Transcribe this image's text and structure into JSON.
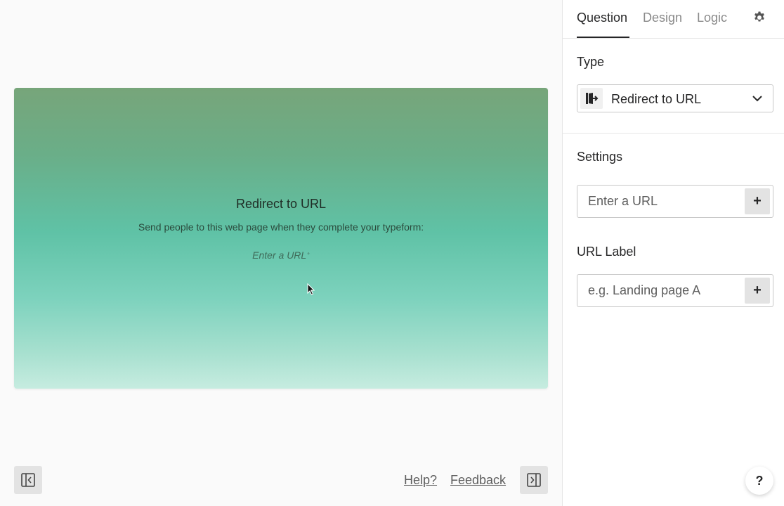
{
  "preview": {
    "title": "Redirect to URL",
    "description": "Send people to this web page when they complete your typeform:",
    "url_placeholder": "Enter a URL",
    "required_mark": "°"
  },
  "footer": {
    "help_link": "Help?",
    "feedback_link": "Feedback"
  },
  "sidebar": {
    "tabs": [
      {
        "label": "Question",
        "active": true
      },
      {
        "label": "Design",
        "active": false
      },
      {
        "label": "Logic",
        "active": false
      }
    ],
    "type": {
      "section_label": "Type",
      "selected_value": "Redirect to URL"
    },
    "settings": {
      "section_label": "Settings",
      "url_placeholder": "Enter a URL",
      "add_button": "+"
    },
    "url_label": {
      "section_label": "URL Label",
      "placeholder": "e.g. Landing page A",
      "add_button": "+"
    },
    "help_button": "?"
  },
  "colors": {
    "accent_text": "#262627",
    "muted_text": "#8a8a8a",
    "card_gradient_top": "#77a57a",
    "card_gradient_bottom": "#c6ece0"
  }
}
